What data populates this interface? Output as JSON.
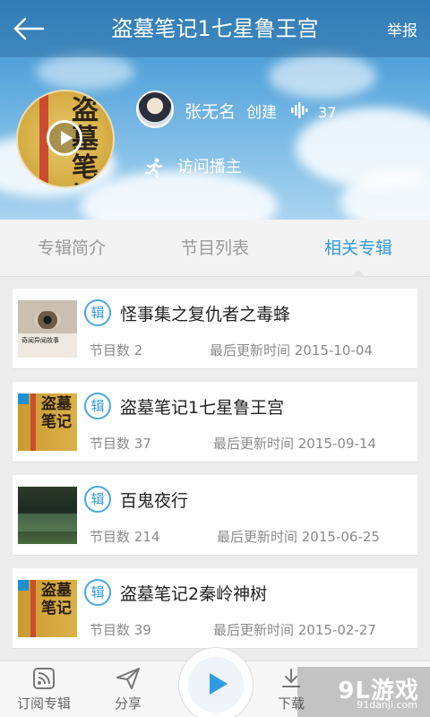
{
  "header": {
    "title": "盗墓笔记1七星鲁王宫",
    "report_label": "举报"
  },
  "album": {
    "cover_glyphs": "盗墓笔记",
    "creator_name": "张无名",
    "creator_role": "创建",
    "listen_count": "37",
    "visit_label": "访问播主"
  },
  "tabs": [
    {
      "label": "专辑简介",
      "active": false
    },
    {
      "label": "节目列表",
      "active": false
    },
    {
      "label": "相关专辑",
      "active": true
    }
  ],
  "badge_text": "辑",
  "related": [
    {
      "title": "怪事集之复仇者之毒蜂",
      "count_label": "节目数 2",
      "updated_label": "最后更新时间 2015-10-04",
      "thumb": "eye",
      "thumb_text": "奇闻异闻故事"
    },
    {
      "title": "盗墓笔记1七星鲁王宫",
      "count_label": "节目数 37",
      "updated_label": "最后更新时间 2015-09-14",
      "thumb": "book",
      "thumb_text": "盗墓笔记"
    },
    {
      "title": "百鬼夜行",
      "count_label": "节目数 214",
      "updated_label": "最后更新时间 2015-06-25",
      "thumb": "forest",
      "thumb_text": ""
    },
    {
      "title": "盗墓笔记2秦岭神树",
      "count_label": "节目数 39",
      "updated_label": "最后更新时间 2015-02-27",
      "thumb": "book",
      "thumb_text": "盗墓笔记"
    }
  ],
  "bottom": {
    "subscribe_label": "订阅专辑",
    "share_label": "分享",
    "download_label": "下载"
  },
  "watermark": {
    "logo": "9L游戏",
    "url": "91danji.com"
  },
  "colors": {
    "accent": "#2f9be0",
    "sky_top": "#3d8fcc",
    "muted_text": "#8a8a8a"
  }
}
